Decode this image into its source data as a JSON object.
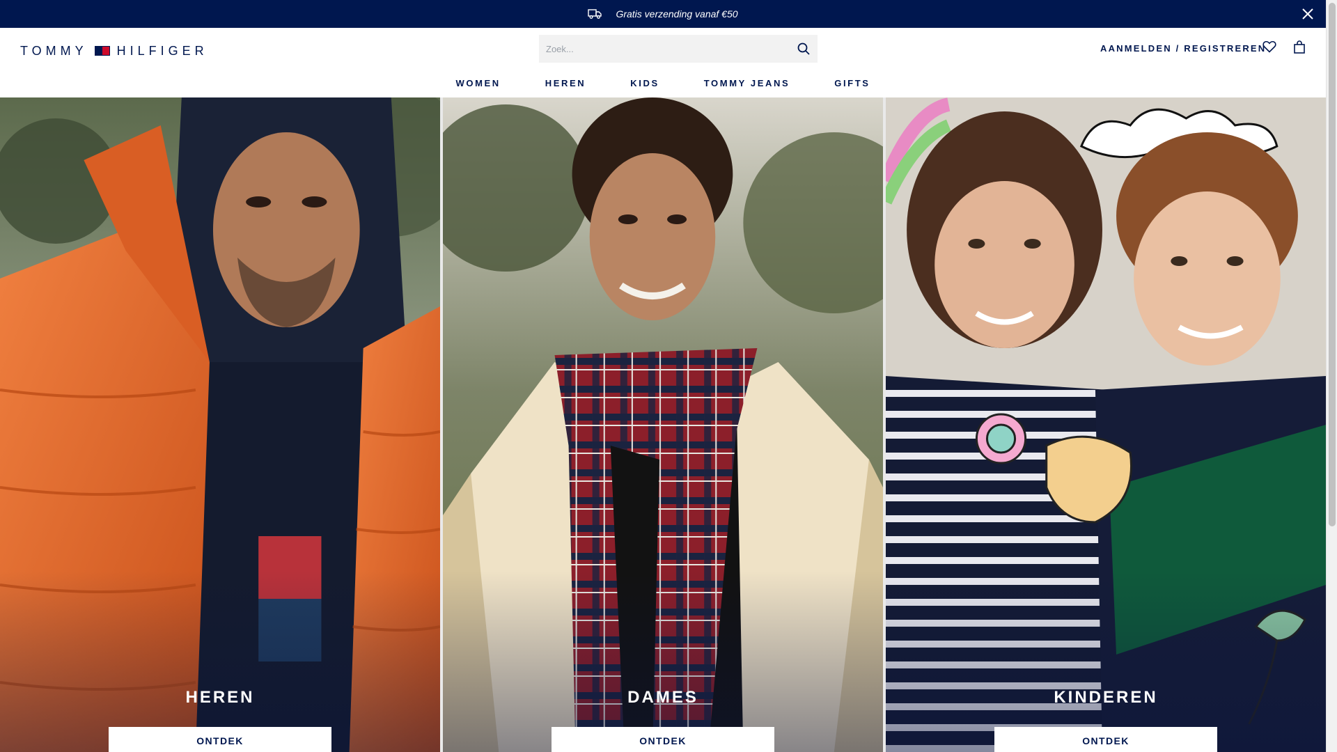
{
  "promo": {
    "text": "Gratis verzending vanaf €50",
    "icon": "truck-icon",
    "close_icon": "close-icon"
  },
  "header": {
    "logo_left": "TOMMY",
    "logo_right": "HILFIGER",
    "search": {
      "placeholder": "Zoek...",
      "value": ""
    },
    "account_label": "AANMELDEN / REGISTREREN",
    "icons": [
      "search-icon",
      "heart-icon",
      "bag-icon"
    ]
  },
  "nav": {
    "items": [
      {
        "label": "WOMEN"
      },
      {
        "label": "HEREN"
      },
      {
        "label": "KIDS"
      },
      {
        "label": "TOMMY JEANS"
      },
      {
        "label": "GIFTS"
      }
    ]
  },
  "hero": {
    "panels": [
      {
        "title": "HEREN",
        "cta": "ONTDEK"
      },
      {
        "title": "DAMES",
        "cta": "ONTDEK"
      },
      {
        "title": "KINDEREN",
        "cta": "ONTDEK"
      }
    ]
  },
  "colors": {
    "navy": "#00174f",
    "red": "#cd0a2b",
    "white": "#ffffff",
    "orange_jacket": "#e8631f",
    "forest_green": "#0f5a3b"
  }
}
